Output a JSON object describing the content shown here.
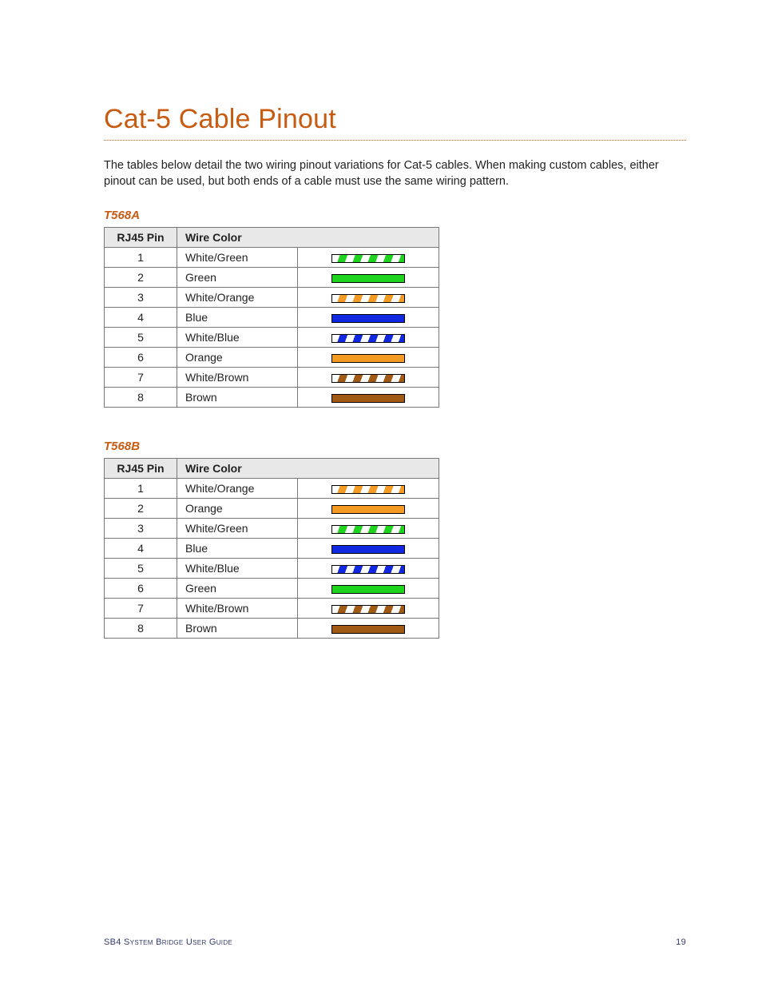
{
  "title": "Cat-5 Cable Pinout",
  "intro": "The tables below detail the two wiring pinout variations for Cat-5 cables. When making custom cables, either pinout can be used, but both ends of a cable must use the same wiring pattern.",
  "colors": {
    "green": "#1fd41f",
    "orange": "#f59a22",
    "blue": "#1029e0",
    "brown": "#a05a14",
    "white": "#ffffff"
  },
  "columns": {
    "pin": "RJ45 Pin",
    "color": "Wire Color"
  },
  "tables": [
    {
      "label": "T568A",
      "rows": [
        {
          "pin": "1",
          "name": "White/Green",
          "striped": true,
          "base": "green"
        },
        {
          "pin": "2",
          "name": "Green",
          "striped": false,
          "base": "green"
        },
        {
          "pin": "3",
          "name": "White/Orange",
          "striped": true,
          "base": "orange"
        },
        {
          "pin": "4",
          "name": "Blue",
          "striped": false,
          "base": "blue"
        },
        {
          "pin": "5",
          "name": "White/Blue",
          "striped": true,
          "base": "blue"
        },
        {
          "pin": "6",
          "name": "Orange",
          "striped": false,
          "base": "orange"
        },
        {
          "pin": "7",
          "name": "White/Brown",
          "striped": true,
          "base": "brown"
        },
        {
          "pin": "8",
          "name": "Brown",
          "striped": false,
          "base": "brown"
        }
      ]
    },
    {
      "label": "T568B",
      "rows": [
        {
          "pin": "1",
          "name": "White/Orange",
          "striped": true,
          "base": "orange"
        },
        {
          "pin": "2",
          "name": "Orange",
          "striped": false,
          "base": "orange"
        },
        {
          "pin": "3",
          "name": "White/Green",
          "striped": true,
          "base": "green"
        },
        {
          "pin": "4",
          "name": "Blue",
          "striped": false,
          "base": "blue"
        },
        {
          "pin": "5",
          "name": "White/Blue",
          "striped": true,
          "base": "blue"
        },
        {
          "pin": "6",
          "name": "Green",
          "striped": false,
          "base": "green"
        },
        {
          "pin": "7",
          "name": "White/Brown",
          "striped": true,
          "base": "brown"
        },
        {
          "pin": "8",
          "name": "Brown",
          "striped": false,
          "base": "brown"
        }
      ]
    }
  ],
  "footer": {
    "guide": "SB4 System Bridge User Guide",
    "page": "19"
  }
}
